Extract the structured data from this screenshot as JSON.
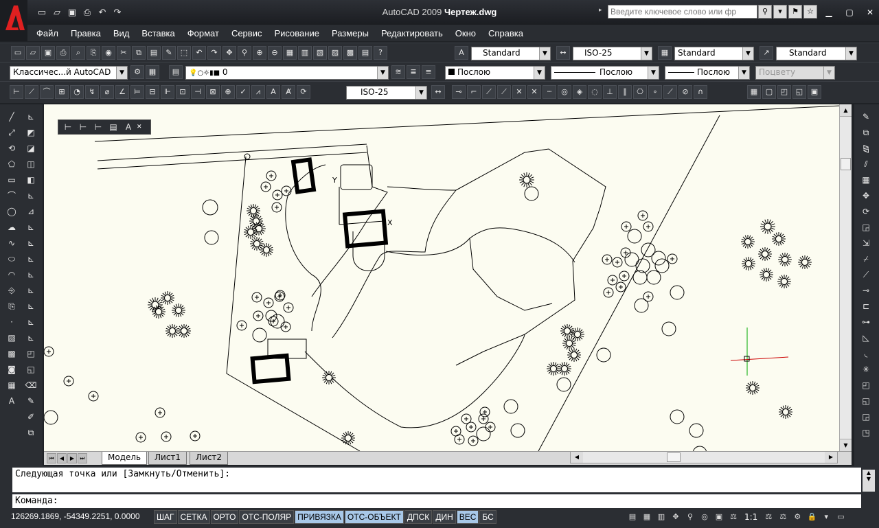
{
  "app": {
    "title_prefix": "AutoCAD 2009",
    "title_file": "Чертеж.dwg",
    "search_placeholder": "Введите ключевое слово или фр"
  },
  "menu": [
    "Файл",
    "Правка",
    "Вид",
    "Вставка",
    "Формат",
    "Сервис",
    "Рисование",
    "Размеры",
    "Редактировать",
    "Окно",
    "Справка"
  ],
  "styles": {
    "text_style": "Standard",
    "dim_style": "ISO-25",
    "table_style": "Standard",
    "multileader_style": "Standard"
  },
  "workspace": "Классичес...й AutoCAD",
  "layer": "0",
  "properties": {
    "color": "Послою",
    "linetype": "Послою",
    "lineweight": "Послою",
    "plotstyle": "Поцвету"
  },
  "dimstyle2": "ISO-25",
  "tabs": [
    "Модель",
    "Лист1",
    "Лист2"
  ],
  "command": {
    "history": "Следующая точка или [Замкнуть/Отменить]:",
    "prompt": "Команда:"
  },
  "status": {
    "coords": "126269.1869, -54349.2251, 0.0000",
    "modes": [
      {
        "label": "ШАГ",
        "on": false
      },
      {
        "label": "СЕТКА",
        "on": false
      },
      {
        "label": "ОРТО",
        "on": false
      },
      {
        "label": "ОТС-ПОЛЯР",
        "on": false
      },
      {
        "label": "ПРИВЯЗКА",
        "on": true
      },
      {
        "label": "ОТС-ОБЪЕКТ",
        "on": true
      },
      {
        "label": "ДПСК",
        "on": false
      },
      {
        "label": "ДИН",
        "on": false
      },
      {
        "label": "ВЕС",
        "on": true
      },
      {
        "label": "БС",
        "on": false
      }
    ],
    "scale": "1:1"
  }
}
